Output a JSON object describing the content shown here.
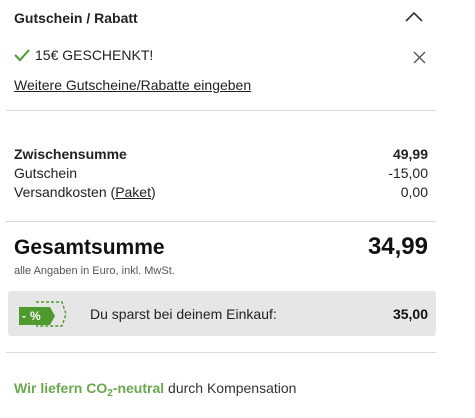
{
  "voucher_section": {
    "title": "Gutschein / Rabatt",
    "applied_text": "15€ GESCHENKT!",
    "more_link": "Weitere Gutscheine/Rabatte eingeben"
  },
  "summary": {
    "subtotal_label": "Zwischensumme",
    "subtotal_value": "49,99",
    "voucher_label": "Gutschein",
    "voucher_value": "-15,00",
    "shipping_label": "Versandkosten",
    "shipping_type": "Paket",
    "shipping_value": "0,00"
  },
  "total": {
    "label": "Gesamtsumme",
    "value": "34,99",
    "note": "alle Angaben in Euro, inkl. MwSt."
  },
  "savings": {
    "icon_text": "%",
    "text": "Du sparst bei deinem Einkauf:",
    "value": "35,00"
  },
  "co2": {
    "green_prefix": "Wir liefern CO",
    "green_subscript": "2",
    "green_suffix": "-neutral",
    "rest": " durch Kompensation"
  },
  "colors": {
    "accent_green": "#6aa84f",
    "icon_green": "#4e9a2e",
    "savings_bg": "#e6e6e6"
  },
  "icons": {
    "collapse": "chevron-up-icon",
    "applied": "check-icon",
    "remove": "close-icon",
    "savings": "discount-tag-icon"
  }
}
